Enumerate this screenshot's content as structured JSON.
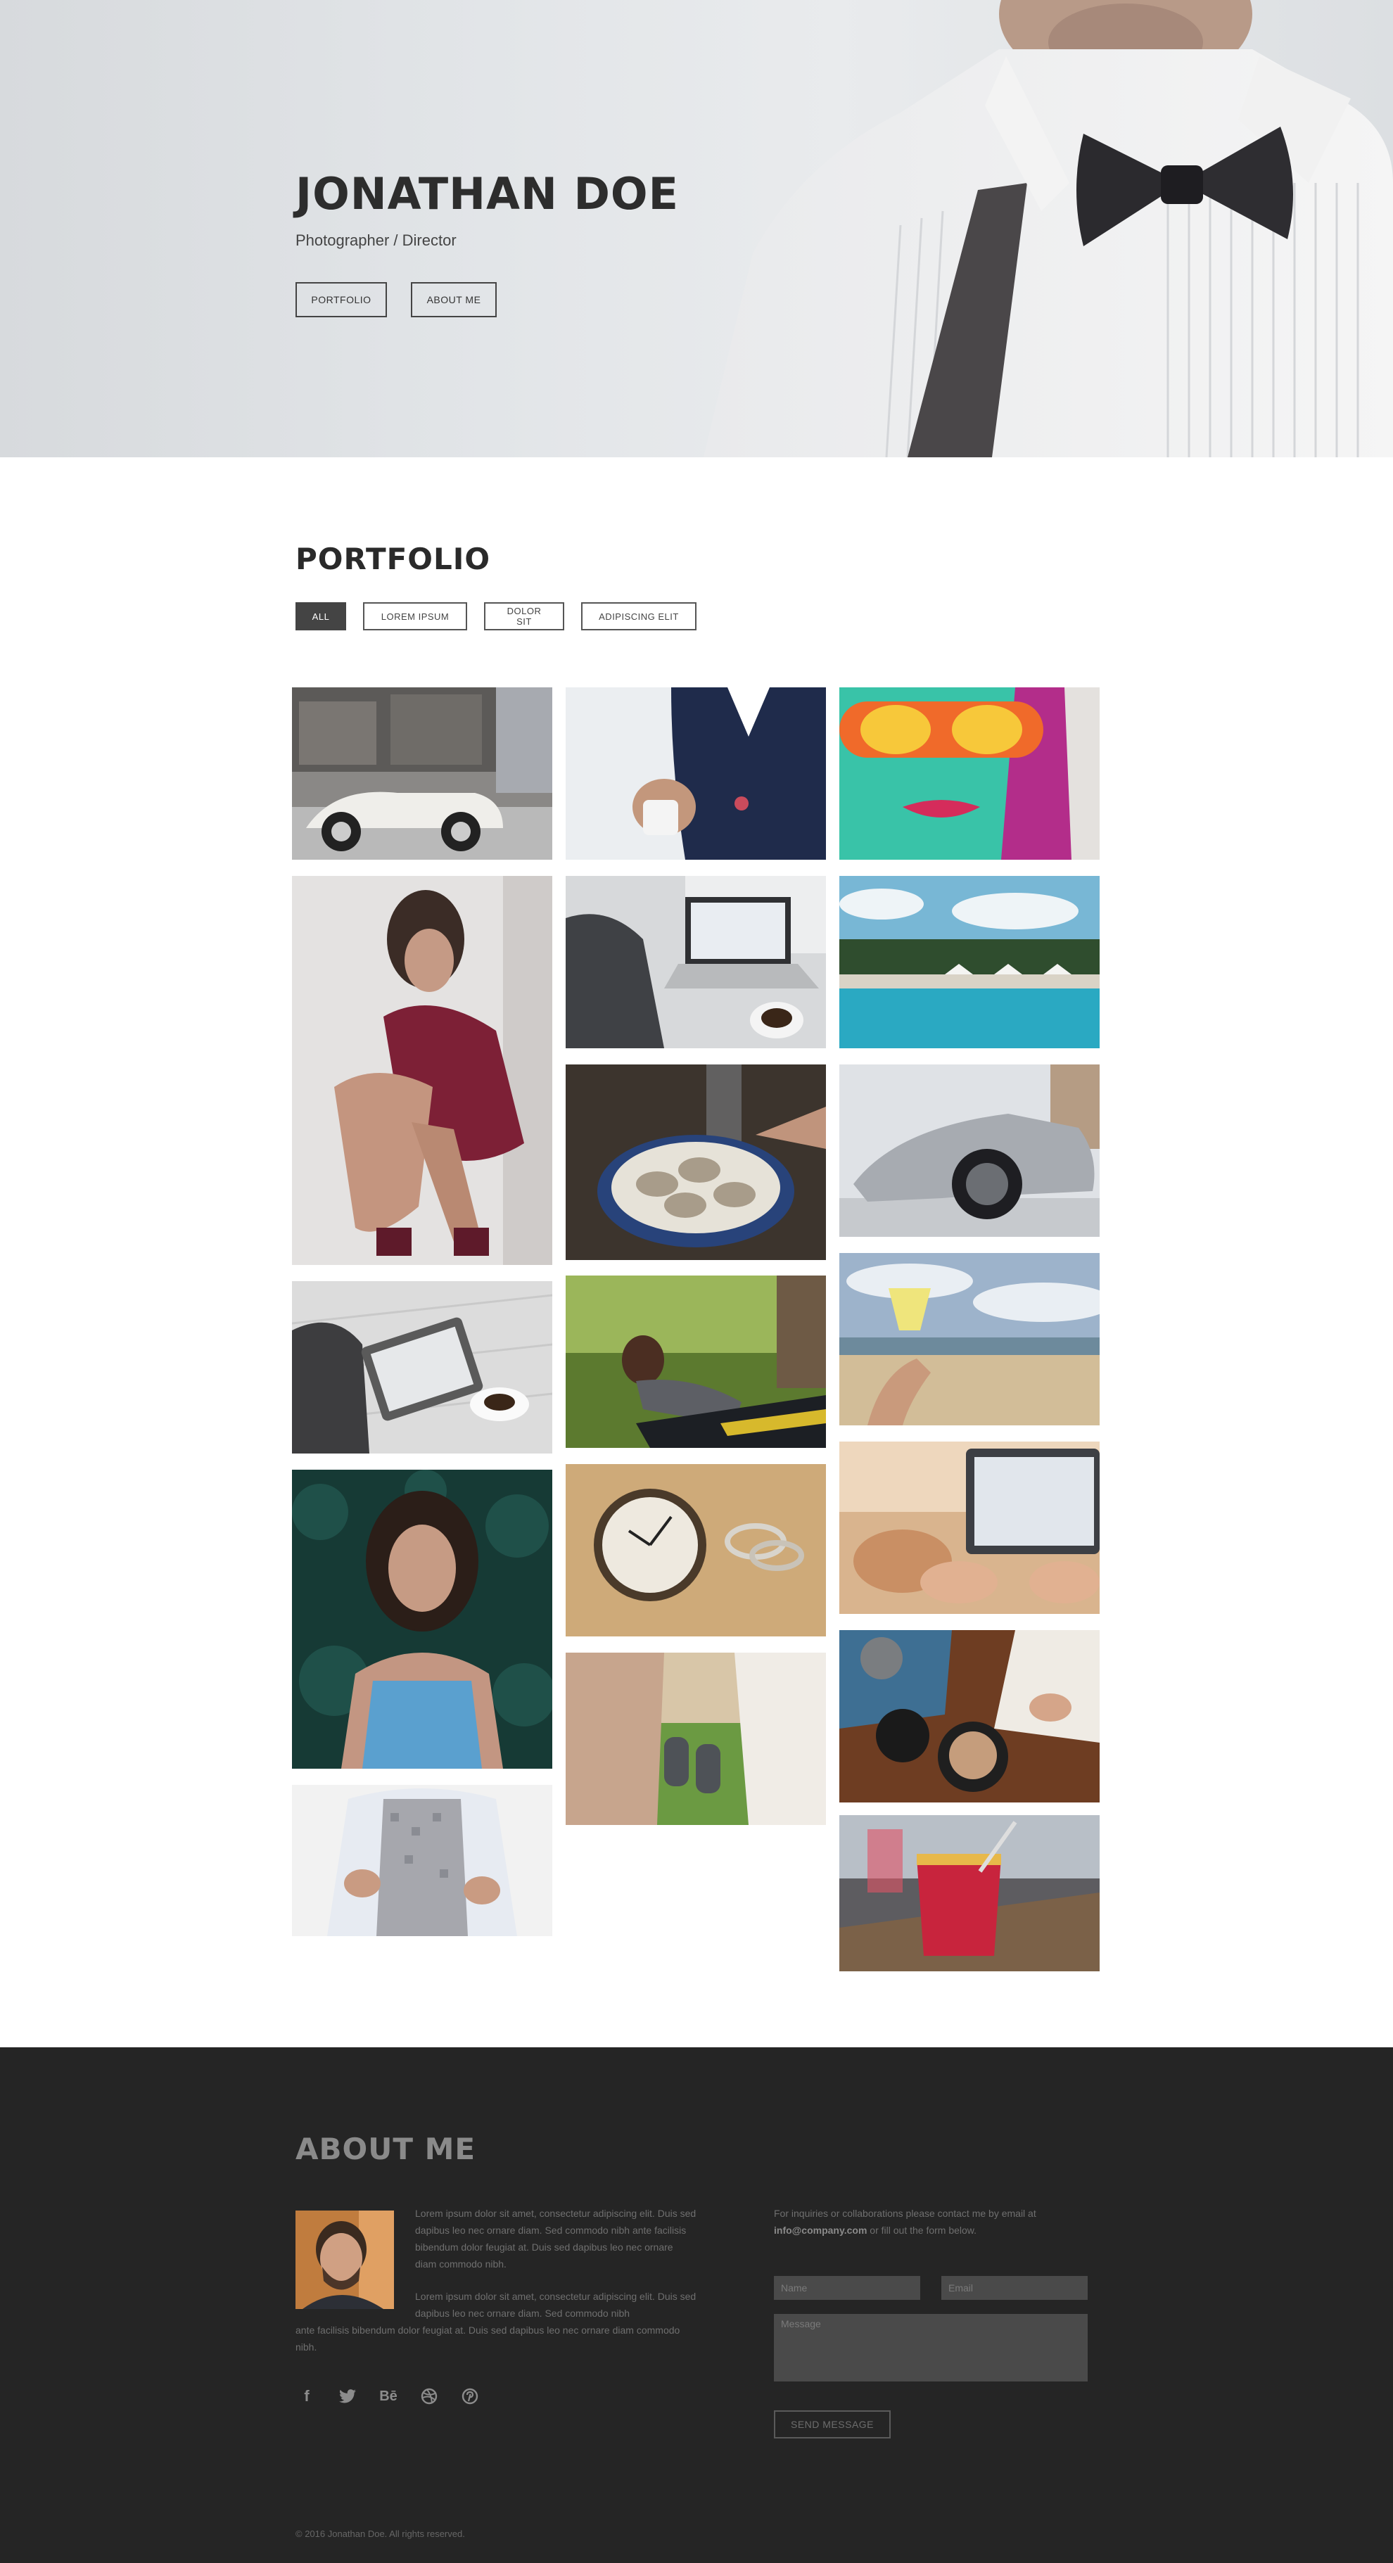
{
  "hero": {
    "name": "JONATHAN DOE",
    "subtitle": "Photographer / Director",
    "buttons": {
      "portfolio": "PORTFOLIO",
      "about": "ABOUT ME"
    }
  },
  "portfolio": {
    "title": "PORTFOLIO",
    "filters": [
      "ALL",
      "LOREM IPSUM",
      "DOLOR SIT",
      "ADIPISCING ELIT"
    ],
    "active_filter": "ALL"
  },
  "about": {
    "title": "ABOUT ME",
    "paragraph1": "Lorem ipsum dolor sit amet, consectetur adipiscing elit. Duis sed dapibus leo nec ornare diam. Sed commodo nibh ante facilisis bibendum dolor feugiat at. Duis sed dapibus leo nec ornare diam commodo nibh.",
    "paragraph2_line1": "Lorem ipsum dolor sit amet, consectetur adipiscing elit. Duis sed dapibus leo nec ornare diam. Sed commodo nibh",
    "paragraph2_line2": "ante facilisis bibendum dolor feugiat at. Duis sed dapibus leo nec ornare diam commodo nibh."
  },
  "contact": {
    "text_prefix": "For inquiries or collaborations please contact me by email at",
    "email": "info@company.com",
    "text_suffix": "or fill out the form below.",
    "name_placeholder": "Name",
    "email_placeholder": "Email",
    "message_placeholder": "Message",
    "send_label": "SEND MESSAGE"
  },
  "social_icons": [
    "facebook-icon",
    "twitter-icon",
    "behance-icon",
    "dribbble-icon",
    "pinterest-icon"
  ],
  "social_glyphs": {
    "facebook": "f",
    "behance": "Bē"
  },
  "footer": {
    "copyright": "© 2016 Jonathan Doe. All rights reserved."
  },
  "colors": {
    "dark": "#252525",
    "active_filter": "#444444",
    "hero_bg": "#e2e5e8"
  }
}
